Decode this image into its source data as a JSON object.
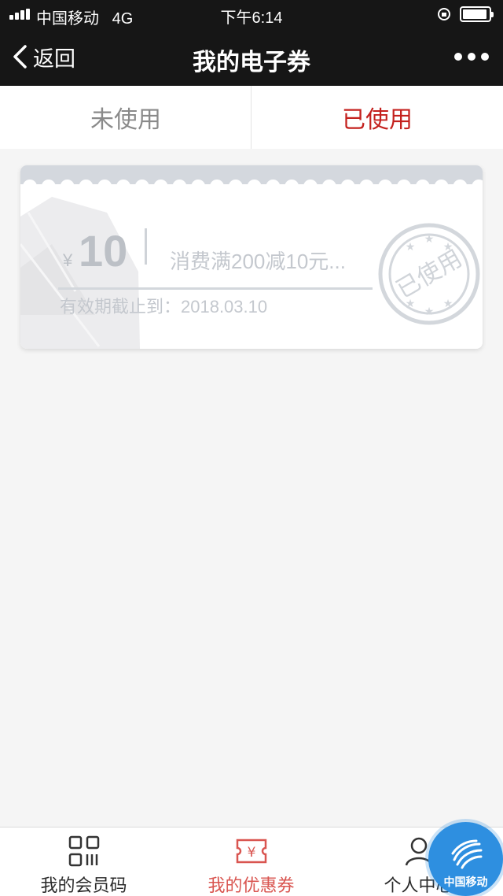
{
  "status_bar": {
    "carrier": "中国移动   4G",
    "time": "下午6:14"
  },
  "nav": {
    "back_label": "返回",
    "title": "我的电子券"
  },
  "tabs": [
    {
      "label": "未使用",
      "active": false
    },
    {
      "label": "已使用",
      "active": true
    }
  ],
  "coupon": {
    "currency": "¥",
    "amount": "10",
    "description": "消费满200减10元...",
    "expiry": "有效期截止到：2018.03.10",
    "stamp_text": "已使用"
  },
  "bottom_nav": [
    {
      "label": "我的会员码",
      "icon": "qr-code-icon",
      "active": false
    },
    {
      "label": "我的优惠券",
      "icon": "coupon-icon",
      "active": true
    },
    {
      "label": "个人中心",
      "icon": "person-icon",
      "active": false
    }
  ],
  "floating_button": {
    "label": "中国移动",
    "icon": "china-mobile-logo-icon"
  },
  "colors": {
    "accent": "#c4211e",
    "header_bg": "#161616",
    "page_bg": "#f5f5f5",
    "floating_button": "#2e8fe0"
  }
}
